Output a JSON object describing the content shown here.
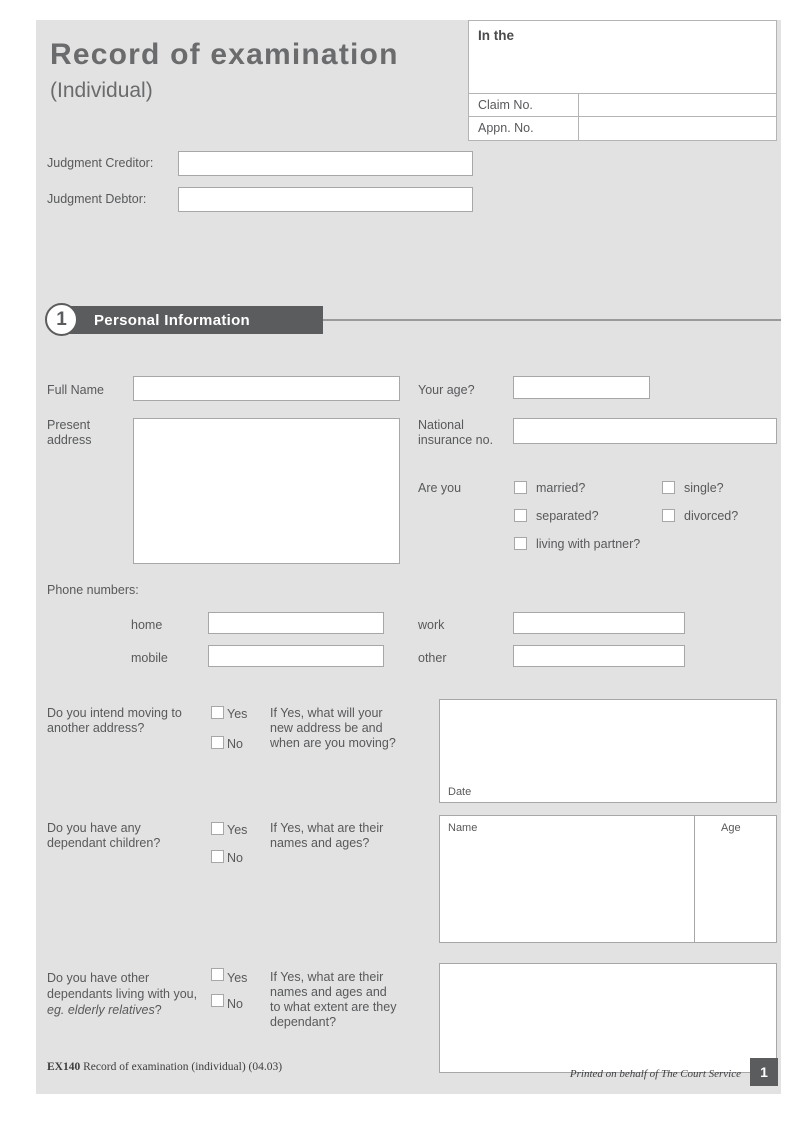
{
  "header": {
    "title": "Record of examination",
    "subtitle": "(Individual)",
    "court_box": {
      "in_the_label": "In the",
      "in_the_value": "",
      "rows": [
        {
          "label": "Claim No.",
          "value": ""
        },
        {
          "label": "Appn. No.",
          "value": ""
        }
      ]
    },
    "parties": [
      {
        "label": "Judgment Creditor:",
        "value": ""
      },
      {
        "label": "Judgment Debtor:",
        "value": ""
      }
    ]
  },
  "section": {
    "number": "1",
    "title": "Personal Information"
  },
  "personal": {
    "full_name_label": "Full Name",
    "full_name_value": "",
    "present_address_label": "Present\naddress",
    "present_address_value": "",
    "age_label": "Your age?",
    "age_value": "",
    "ni_label": "National\ninsurance no.",
    "ni_value": "",
    "are_you_label": "Are you",
    "status_options": [
      {
        "label": "married?",
        "checked": false
      },
      {
        "label": "single?",
        "checked": false
      },
      {
        "label": "separated?",
        "checked": false
      },
      {
        "label": "divorced?",
        "checked": false
      },
      {
        "label": "living with partner?",
        "checked": false
      }
    ]
  },
  "phones": {
    "heading": "Phone numbers:",
    "fields": [
      {
        "label": "home",
        "value": ""
      },
      {
        "label": "work",
        "value": ""
      },
      {
        "label": "mobile",
        "value": ""
      },
      {
        "label": "other",
        "value": ""
      }
    ]
  },
  "questions": [
    {
      "question": "Do you intend moving to\nanother address?",
      "yes_label": "Yes",
      "no_label": "No",
      "yes_checked": false,
      "no_checked": false,
      "prompt": "If Yes, what will your\nnew address be and\nwhen are you moving?",
      "answer_value": "",
      "inner_label": "Date"
    },
    {
      "question": "Do you have any\ndependant children?",
      "yes_label": "Yes",
      "no_label": "No",
      "yes_checked": false,
      "no_checked": false,
      "prompt": "If Yes, what are their\nnames and ages?",
      "answer_value": "",
      "col_name": "Name",
      "col_age": "Age"
    },
    {
      "question_line1": "Do you have other",
      "question_line2": "dependants living with you,",
      "question_line3_italic": "eg. elderly relatives",
      "question_line3_tail": "?",
      "yes_label": "Yes",
      "no_label": "No",
      "yes_checked": false,
      "no_checked": false,
      "prompt": "If Yes, what are their\nnames and ages and\nto what extent are they\ndependant?",
      "answer_value": ""
    }
  ],
  "footer": {
    "code": "EX140",
    "description": "Record of examination (individual) (04.03)",
    "printed_by": "Printed on behalf of The Court Service",
    "page_number": "1"
  },
  "colors": {
    "page_bg": "#e2e2e2",
    "ink": "#58595b",
    "bar": "#5b5c5e",
    "field_bg": "#ffffff",
    "field_border": "#a7a7a7"
  }
}
